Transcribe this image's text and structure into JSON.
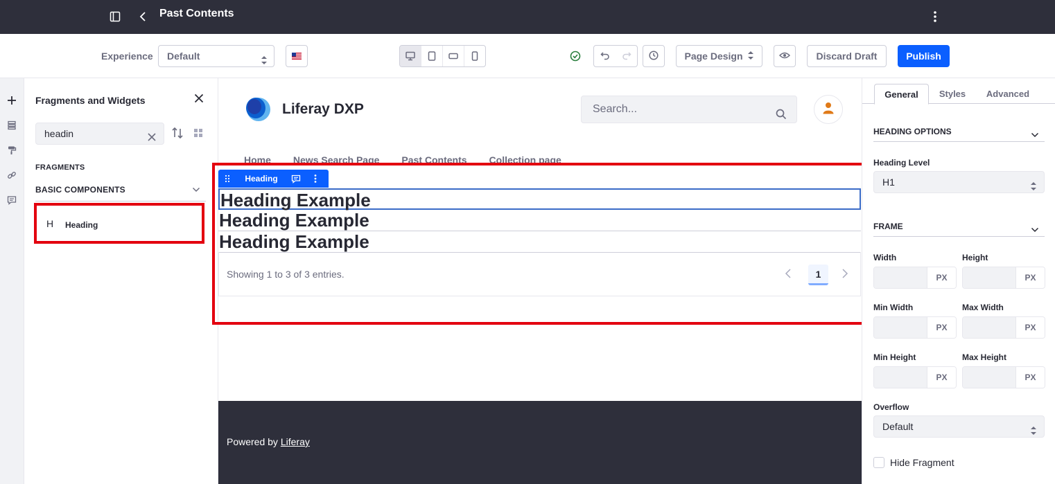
{
  "topbar": {
    "title": "Past Contents"
  },
  "toolbar": {
    "experience_label": "Experience",
    "experience_value": "Default",
    "page_design_label": "Page Design",
    "discard_label": "Discard Draft",
    "publish_label": "Publish"
  },
  "left_panel": {
    "title": "Fragments and Widgets",
    "search_value": "headin",
    "fragments_label": "FRAGMENTS",
    "collection_label": "BASIC COMPONENTS",
    "item_icon": "H",
    "item_label": "Heading"
  },
  "site": {
    "name": "Liferay DXP",
    "search_placeholder": "Search...",
    "nav": [
      "Home",
      "News Search Page",
      "Past Contents",
      "Collection page"
    ],
    "fragment_toolbar_label": "Heading",
    "headings": [
      "Heading Example",
      "Heading Example",
      "Heading Example"
    ],
    "pager_info": "Showing 1 to 3 of 3 entries.",
    "current_page": "1",
    "footer_text": "Powered by ",
    "footer_link": "Liferay"
  },
  "right_panel": {
    "tabs": [
      "General",
      "Styles",
      "Advanced"
    ],
    "heading_options_label": "HEADING OPTIONS",
    "heading_level_label": "Heading Level",
    "heading_level_value": "H1",
    "frame_label": "FRAME",
    "width_label": "Width",
    "height_label": "Height",
    "min_width_label": "Min Width",
    "max_width_label": "Max Width",
    "min_height_label": "Min Height",
    "max_height_label": "Max Height",
    "unit": "PX",
    "overflow_label": "Overflow",
    "overflow_value": "Default",
    "hide_fragment_label": "Hide Fragment"
  },
  "colors": {
    "primary": "#0b5fff",
    "highlight": "#e3000f",
    "dark": "#2e2f3b"
  }
}
